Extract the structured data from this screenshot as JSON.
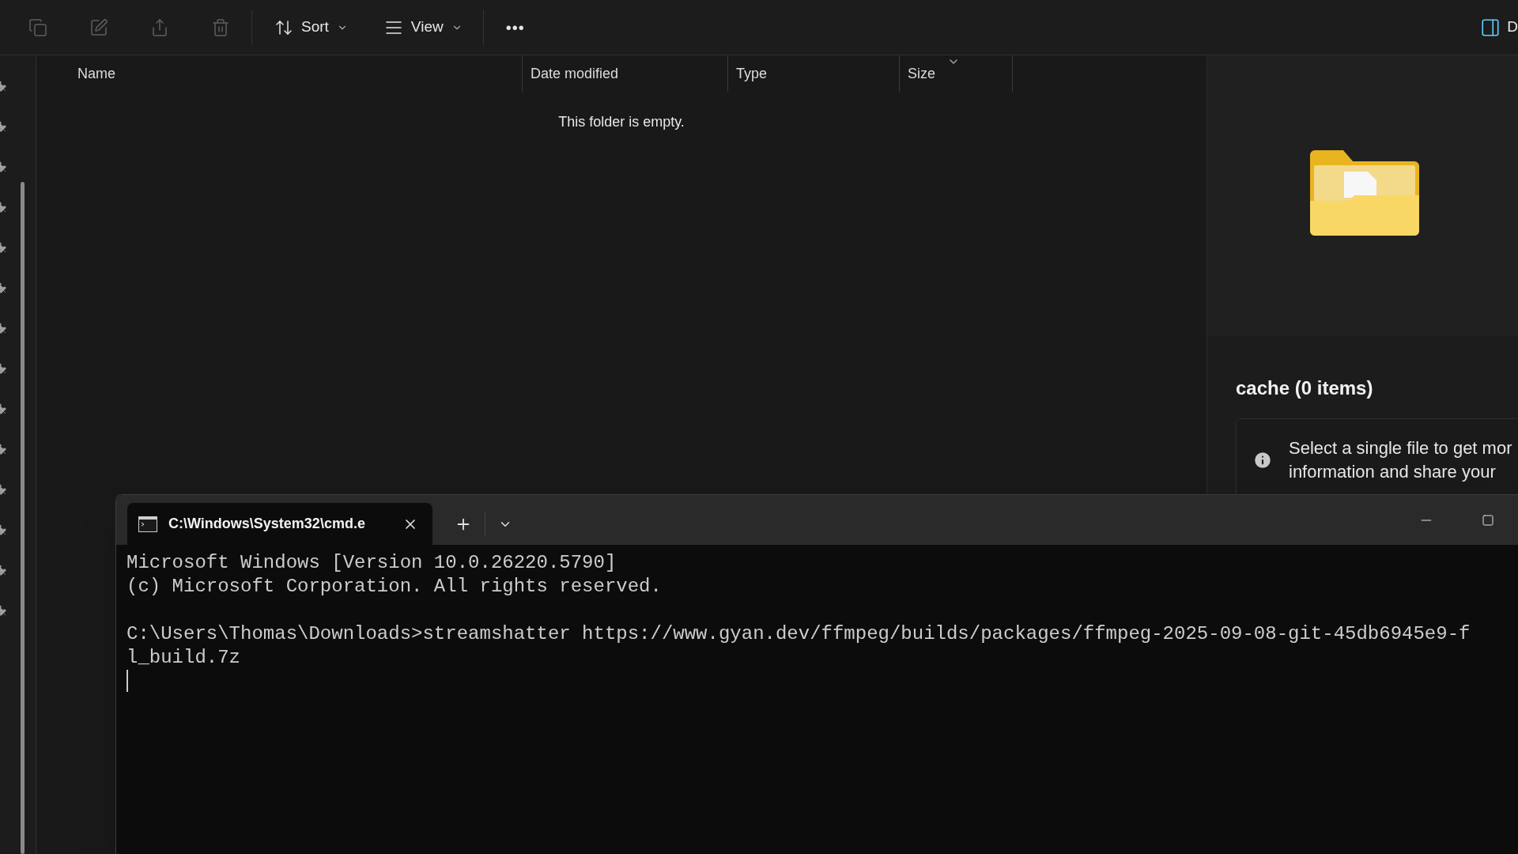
{
  "toolbar": {
    "icon_buttons": [
      {
        "disabled": true
      },
      {
        "disabled": true
      },
      {
        "disabled": true
      },
      {
        "disabled": true
      }
    ],
    "menus": [
      {
        "label": "Sort"
      },
      {
        "label": "View"
      }
    ],
    "more": "•••",
    "details_label": "D"
  },
  "columns": [
    {
      "label": "Name",
      "sorted": false
    },
    {
      "label": "Date modified",
      "sorted": false
    },
    {
      "label": "Type",
      "sorted": false
    },
    {
      "label": "Size",
      "sorted": true
    }
  ],
  "empty_message": "This folder is empty.",
  "preview": {
    "title": "cache (0 items)",
    "info_lines": [
      "Select a single file to get mor",
      "information and share your"
    ]
  },
  "terminal": {
    "tab_title": "C:\\Windows\\System32\\cmd.e",
    "blocks": [
      [
        "Microsoft Windows [Version 10.0.26220.5790]",
        "(c) Microsoft Corporation. All rights reserved."
      ],
      [
        "C:\\Users\\Thomas\\Downloads>streamshatter https://www.gyan.dev/ffmpeg/builds/packages/ffmpeg-2025-09-08-git-45db6945e9-f",
        "l_build.7z"
      ]
    ],
    "cursor": true
  }
}
